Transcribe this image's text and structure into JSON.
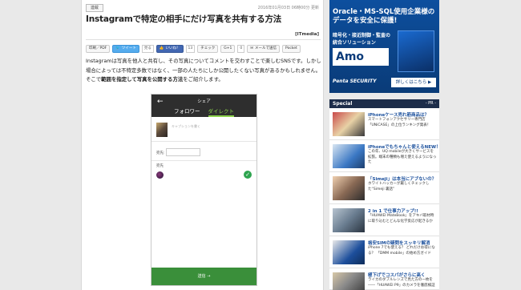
{
  "article": {
    "tag": "連載",
    "date": "2016年01月03日 06時00分 更新",
    "title": "Instagramで特定の相手にだけ写真を共有する方法",
    "source": "[ITmedia]",
    "social": {
      "print": "印刷／PDF",
      "tweet": "ツイート",
      "tweet_count": "見る",
      "like": "いいね！",
      "like_count": "13",
      "check": "チェック",
      "gplus": "G+1",
      "gplus_count": "0",
      "mail": "メールで送信",
      "hatena": "",
      "pocket": "Pocket"
    },
    "body_pre": "Instagramは写真を他人と共有し、その写真についてコメントを交わすことで楽しむSNSです。しかし場合によっては不特定多数ではなく、一部の人たちにしか公開したくない写真があるかもしれません。そこで",
    "body_em": "範囲を指定して写真を公開する方法",
    "body_post": "をご紹介します。"
  },
  "phone": {
    "back": "←",
    "title": "シェア",
    "tab_follower": "フォロワー",
    "tab_direct": "ダイレクト",
    "caption_placeholder": "キャプションを書く",
    "dest_label": "宛先:",
    "send_label": "宛先",
    "send_button": "送信 →"
  },
  "sidebar": {
    "ad": {
      "line1": "Oracle・MS-SQL使用企業様の",
      "line2": "データを安全に保護!",
      "line3": "暗号化・接近制御・監査の",
      "line4": "統合ソリューション",
      "logo": "Amo",
      "brand": "Penta SECURITY",
      "button": "詳しくはこちら ▶"
    },
    "special_header": "Special",
    "special_pr": "- PR -",
    "items": [
      {
        "title": "iPhoneケース売れ筋商品は？",
        "desc": "スマートフォンアクセサリー専門店「UNiCASE」の上位ランキング発表！"
      },
      {
        "title": "iPhoneでもちゃんと使えるNEW！",
        "desc": "この年、UQ mobileが大きくサービスを拡張。端末の種類も増え使えるようになった"
      },
      {
        "title": "「Simeji」は本当にアブないの？",
        "desc": "ホワイトハッカーが厳しくチェックした“Simeji 裏話”"
      },
      {
        "title": "2 in 1 で仕事力アップ!!",
        "desc": "「HUAWEI MateBook」をアキバ取材時に取り込むとどんな化学反応が起きるか"
      },
      {
        "title": "格安SIMの疑問をスッキリ解消",
        "desc": "iPhone 7でも使える？ どれだけお得になる？ 「DMM mobile」の始め方ガイド"
      },
      {
        "title": "極下げでコスパがさらに高く",
        "desc": "ライカのダブルレンズで見た方の一枚を――「HUAWEI P9」のカメラを徹底検証"
      }
    ]
  },
  "colors": {
    "accent_green": "#8bd24b",
    "special_header_bg": "#1d2d4a",
    "ad_bg": "#0d4f9e",
    "link_blue": "#1a4f9c"
  }
}
